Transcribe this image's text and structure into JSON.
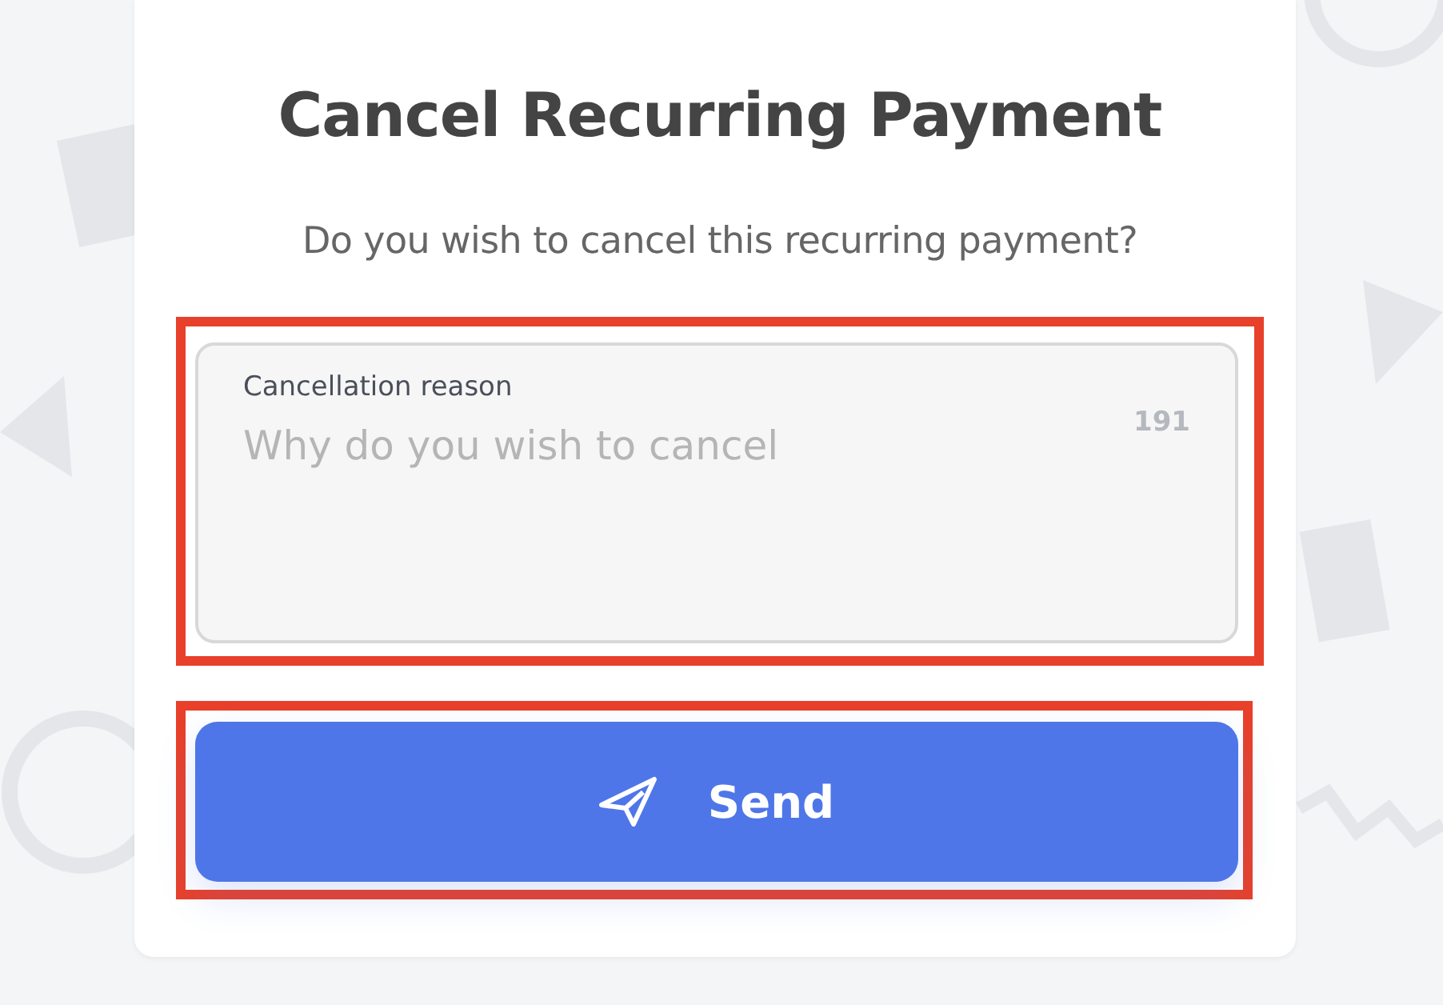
{
  "dialog": {
    "title": "Cancel Recurring Payment",
    "message": "Do you wish to cancel this recurring payment?",
    "reason_field": {
      "label": "Cancellation reason",
      "placeholder": "Why do you wish to cancel",
      "counter": "191",
      "highlighted": true
    },
    "send_button": {
      "label": "Send",
      "highlighted": true
    }
  }
}
